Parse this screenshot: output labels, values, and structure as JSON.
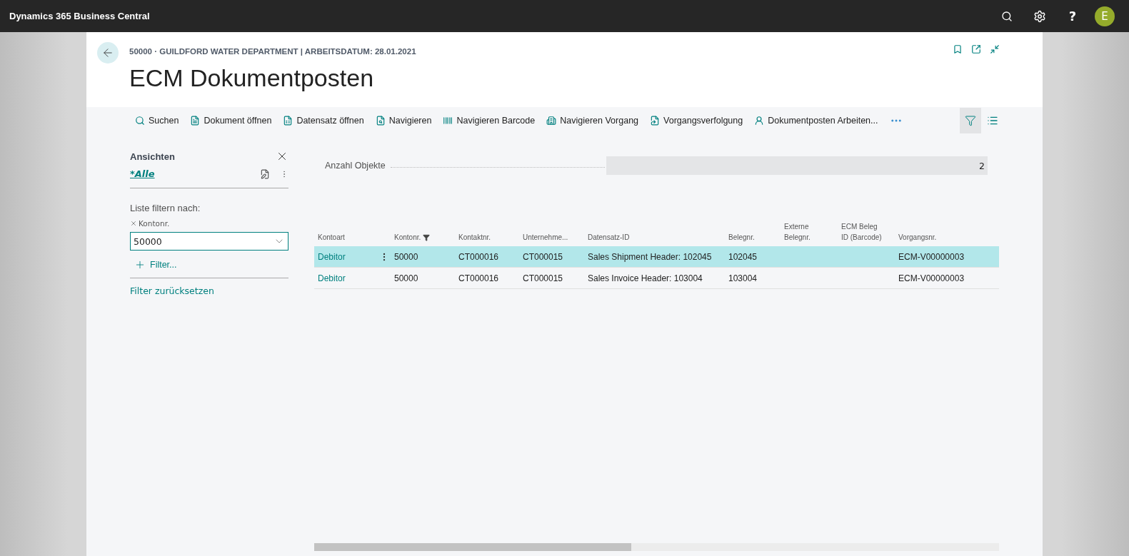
{
  "app_bar": {
    "title": "Dynamics 365 Business Central",
    "help": "?",
    "avatar": "E"
  },
  "page": {
    "breadcrumb": "50000 · GUILDFORD WATER DEPARTMENT | ARBEITSDATUM: 28.01.2021",
    "title": "ECM Dokumentposten"
  },
  "toolbar": {
    "actions": [
      {
        "label": "Suchen",
        "kind": "search"
      },
      {
        "label": "Dokument öffnen",
        "kind": "document"
      },
      {
        "label": "Datensatz öffnen",
        "kind": "record"
      },
      {
        "label": "Navigieren",
        "kind": "navigate"
      },
      {
        "label": "Navigieren Barcode",
        "kind": "barcode"
      },
      {
        "label": "Navigieren Vorgang",
        "kind": "building"
      },
      {
        "label": "Vorgangsverfolgung",
        "kind": "tracking"
      },
      {
        "label": "Dokumentposten Arbeiten...",
        "kind": "person"
      }
    ],
    "filter_pane_open": true
  },
  "filter_pane": {
    "title": "Ansichten",
    "view": "*Alle",
    "filter_heading": "Liste filtern nach:",
    "filters": [
      {
        "field": "Kontonr.",
        "value": "50000"
      }
    ],
    "add_filter": "Filter...",
    "reset": "Filter zurücksetzen"
  },
  "summary": {
    "label": "Anzahl Objekte",
    "value": "2"
  },
  "table": {
    "columns": [
      {
        "label": "Kontoart",
        "filtered": false
      },
      {
        "label": "Kontonr.",
        "filtered": true
      },
      {
        "label": "Kontaktnr.",
        "filtered": false
      },
      {
        "label": "Unternehme...",
        "filtered": false
      },
      {
        "label": "Datensatz-ID",
        "filtered": false
      },
      {
        "label": "Belegnr.",
        "filtered": false
      },
      {
        "label": "Externe Belegnr.",
        "filtered": false
      },
      {
        "label": "ECM Beleg ID (Barcode)",
        "filtered": false
      },
      {
        "label": "Vorgangsnr.",
        "filtered": false
      }
    ],
    "rows": [
      {
        "selected": true,
        "cells": [
          "Debitor",
          "50000",
          "CT000016",
          "CT000015",
          "Sales Shipment Header: 102045",
          "102045",
          "",
          "",
          "ECM-V00000003"
        ]
      },
      {
        "selected": false,
        "cells": [
          "Debitor",
          "50000",
          "CT000016",
          "CT000015",
          "Sales Invoice Header: 103004",
          "103004",
          "",
          "",
          "ECM-V00000003"
        ]
      }
    ]
  }
}
